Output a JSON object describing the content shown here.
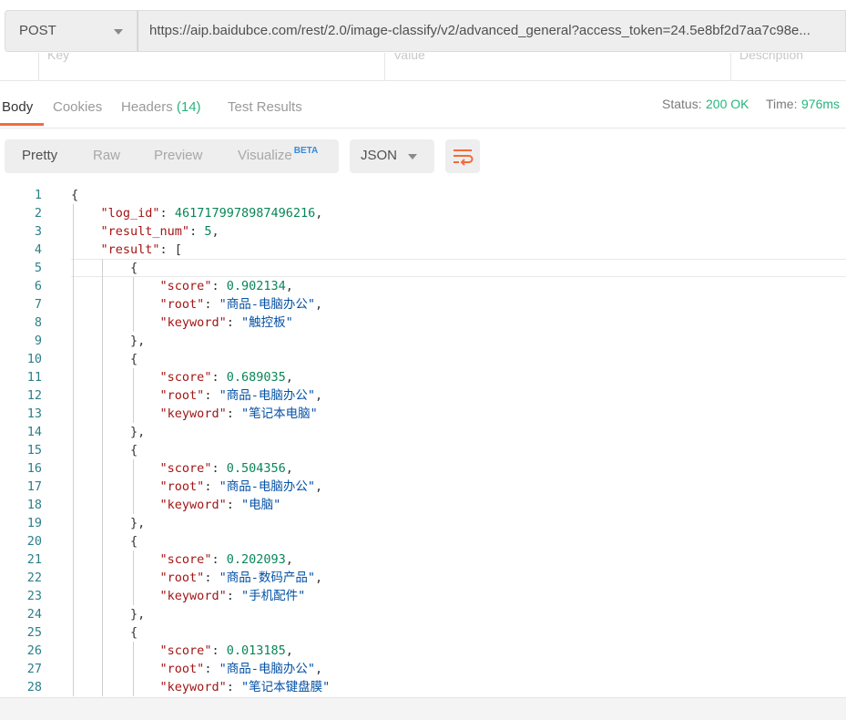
{
  "request": {
    "method": "POST",
    "url": "https://aip.baidubce.com/rest/2.0/image-classify/v2/advanced_general?access_token=24.5e8bf2d7aa7c98e..."
  },
  "params_header": {
    "key": "Key",
    "value": "Value",
    "description": "Description"
  },
  "response_tabs": {
    "body": "Body",
    "cookies": "Cookies",
    "headers": "Headers",
    "headers_count": "(14)",
    "test_results": "Test Results"
  },
  "status": {
    "status_label": "Status:",
    "status_value": "200 OK",
    "time_label": "Time:",
    "time_value": "976ms"
  },
  "format_toolbar": {
    "pretty": "Pretty",
    "raw": "Raw",
    "preview": "Preview",
    "visualize": "Visualize",
    "beta": "BETA",
    "language": "JSON",
    "wrap_icon": "wrap-lines-icon"
  },
  "colors": {
    "accent": "#f26b3a",
    "status_ok": "#26b47f",
    "json_key": "#a31515",
    "json_string": "#0451a5",
    "json_number": "#098658"
  },
  "code_lines": [
    {
      "n": "1",
      "t": [
        {
          "c": "p",
          "v": "{"
        }
      ]
    },
    {
      "n": "2",
      "t": [
        {
          "c": "p",
          "v": "    "
        },
        {
          "c": "k",
          "v": "\"log_id\""
        },
        {
          "c": "p",
          "v": ": "
        },
        {
          "c": "n",
          "v": "4617179978987496216"
        },
        {
          "c": "p",
          "v": ","
        }
      ]
    },
    {
      "n": "3",
      "t": [
        {
          "c": "p",
          "v": "    "
        },
        {
          "c": "k",
          "v": "\"result_num\""
        },
        {
          "c": "p",
          "v": ": "
        },
        {
          "c": "n",
          "v": "5"
        },
        {
          "c": "p",
          "v": ","
        }
      ]
    },
    {
      "n": "4",
      "t": [
        {
          "c": "p",
          "v": "    "
        },
        {
          "c": "k",
          "v": "\"result\""
        },
        {
          "c": "p",
          "v": ": ["
        }
      ]
    },
    {
      "n": "5",
      "t": [
        {
          "c": "p",
          "v": "        {"
        }
      ]
    },
    {
      "n": "6",
      "t": [
        {
          "c": "p",
          "v": "            "
        },
        {
          "c": "k",
          "v": "\"score\""
        },
        {
          "c": "p",
          "v": ": "
        },
        {
          "c": "n",
          "v": "0.902134"
        },
        {
          "c": "p",
          "v": ","
        }
      ]
    },
    {
      "n": "7",
      "t": [
        {
          "c": "p",
          "v": "            "
        },
        {
          "c": "k",
          "v": "\"root\""
        },
        {
          "c": "p",
          "v": ": "
        },
        {
          "c": "s",
          "v": "\"商品-电脑办公\""
        },
        {
          "c": "p",
          "v": ","
        }
      ]
    },
    {
      "n": "8",
      "t": [
        {
          "c": "p",
          "v": "            "
        },
        {
          "c": "k",
          "v": "\"keyword\""
        },
        {
          "c": "p",
          "v": ": "
        },
        {
          "c": "s",
          "v": "\"触控板\""
        }
      ]
    },
    {
      "n": "9",
      "t": [
        {
          "c": "p",
          "v": "        },"
        }
      ]
    },
    {
      "n": "10",
      "t": [
        {
          "c": "p",
          "v": "        {"
        }
      ]
    },
    {
      "n": "11",
      "t": [
        {
          "c": "p",
          "v": "            "
        },
        {
          "c": "k",
          "v": "\"score\""
        },
        {
          "c": "p",
          "v": ": "
        },
        {
          "c": "n",
          "v": "0.689035"
        },
        {
          "c": "p",
          "v": ","
        }
      ]
    },
    {
      "n": "12",
      "t": [
        {
          "c": "p",
          "v": "            "
        },
        {
          "c": "k",
          "v": "\"root\""
        },
        {
          "c": "p",
          "v": ": "
        },
        {
          "c": "s",
          "v": "\"商品-电脑办公\""
        },
        {
          "c": "p",
          "v": ","
        }
      ]
    },
    {
      "n": "13",
      "t": [
        {
          "c": "p",
          "v": "            "
        },
        {
          "c": "k",
          "v": "\"keyword\""
        },
        {
          "c": "p",
          "v": ": "
        },
        {
          "c": "s",
          "v": "\"笔记本电脑\""
        }
      ]
    },
    {
      "n": "14",
      "t": [
        {
          "c": "p",
          "v": "        },"
        }
      ]
    },
    {
      "n": "15",
      "t": [
        {
          "c": "p",
          "v": "        {"
        }
      ]
    },
    {
      "n": "16",
      "t": [
        {
          "c": "p",
          "v": "            "
        },
        {
          "c": "k",
          "v": "\"score\""
        },
        {
          "c": "p",
          "v": ": "
        },
        {
          "c": "n",
          "v": "0.504356"
        },
        {
          "c": "p",
          "v": ","
        }
      ]
    },
    {
      "n": "17",
      "t": [
        {
          "c": "p",
          "v": "            "
        },
        {
          "c": "k",
          "v": "\"root\""
        },
        {
          "c": "p",
          "v": ": "
        },
        {
          "c": "s",
          "v": "\"商品-电脑办公\""
        },
        {
          "c": "p",
          "v": ","
        }
      ]
    },
    {
      "n": "18",
      "t": [
        {
          "c": "p",
          "v": "            "
        },
        {
          "c": "k",
          "v": "\"keyword\""
        },
        {
          "c": "p",
          "v": ": "
        },
        {
          "c": "s",
          "v": "\"电脑\""
        }
      ]
    },
    {
      "n": "19",
      "t": [
        {
          "c": "p",
          "v": "        },"
        }
      ]
    },
    {
      "n": "20",
      "t": [
        {
          "c": "p",
          "v": "        {"
        }
      ]
    },
    {
      "n": "21",
      "t": [
        {
          "c": "p",
          "v": "            "
        },
        {
          "c": "k",
          "v": "\"score\""
        },
        {
          "c": "p",
          "v": ": "
        },
        {
          "c": "n",
          "v": "0.202093"
        },
        {
          "c": "p",
          "v": ","
        }
      ]
    },
    {
      "n": "22",
      "t": [
        {
          "c": "p",
          "v": "            "
        },
        {
          "c": "k",
          "v": "\"root\""
        },
        {
          "c": "p",
          "v": ": "
        },
        {
          "c": "s",
          "v": "\"商品-数码产品\""
        },
        {
          "c": "p",
          "v": ","
        }
      ]
    },
    {
      "n": "23",
      "t": [
        {
          "c": "p",
          "v": "            "
        },
        {
          "c": "k",
          "v": "\"keyword\""
        },
        {
          "c": "p",
          "v": ": "
        },
        {
          "c": "s",
          "v": "\"手机配件\""
        }
      ]
    },
    {
      "n": "24",
      "t": [
        {
          "c": "p",
          "v": "        },"
        }
      ]
    },
    {
      "n": "25",
      "t": [
        {
          "c": "p",
          "v": "        {"
        }
      ]
    },
    {
      "n": "26",
      "t": [
        {
          "c": "p",
          "v": "            "
        },
        {
          "c": "k",
          "v": "\"score\""
        },
        {
          "c": "p",
          "v": ": "
        },
        {
          "c": "n",
          "v": "0.013185"
        },
        {
          "c": "p",
          "v": ","
        }
      ]
    },
    {
      "n": "27",
      "t": [
        {
          "c": "p",
          "v": "            "
        },
        {
          "c": "k",
          "v": "\"root\""
        },
        {
          "c": "p",
          "v": ": "
        },
        {
          "c": "s",
          "v": "\"商品-电脑办公\""
        },
        {
          "c": "p",
          "v": ","
        }
      ]
    },
    {
      "n": "28",
      "t": [
        {
          "c": "p",
          "v": "            "
        },
        {
          "c": "k",
          "v": "\"keyword\""
        },
        {
          "c": "p",
          "v": ": "
        },
        {
          "c": "s",
          "v": "\"笔记本键盘膜\""
        }
      ]
    }
  ]
}
